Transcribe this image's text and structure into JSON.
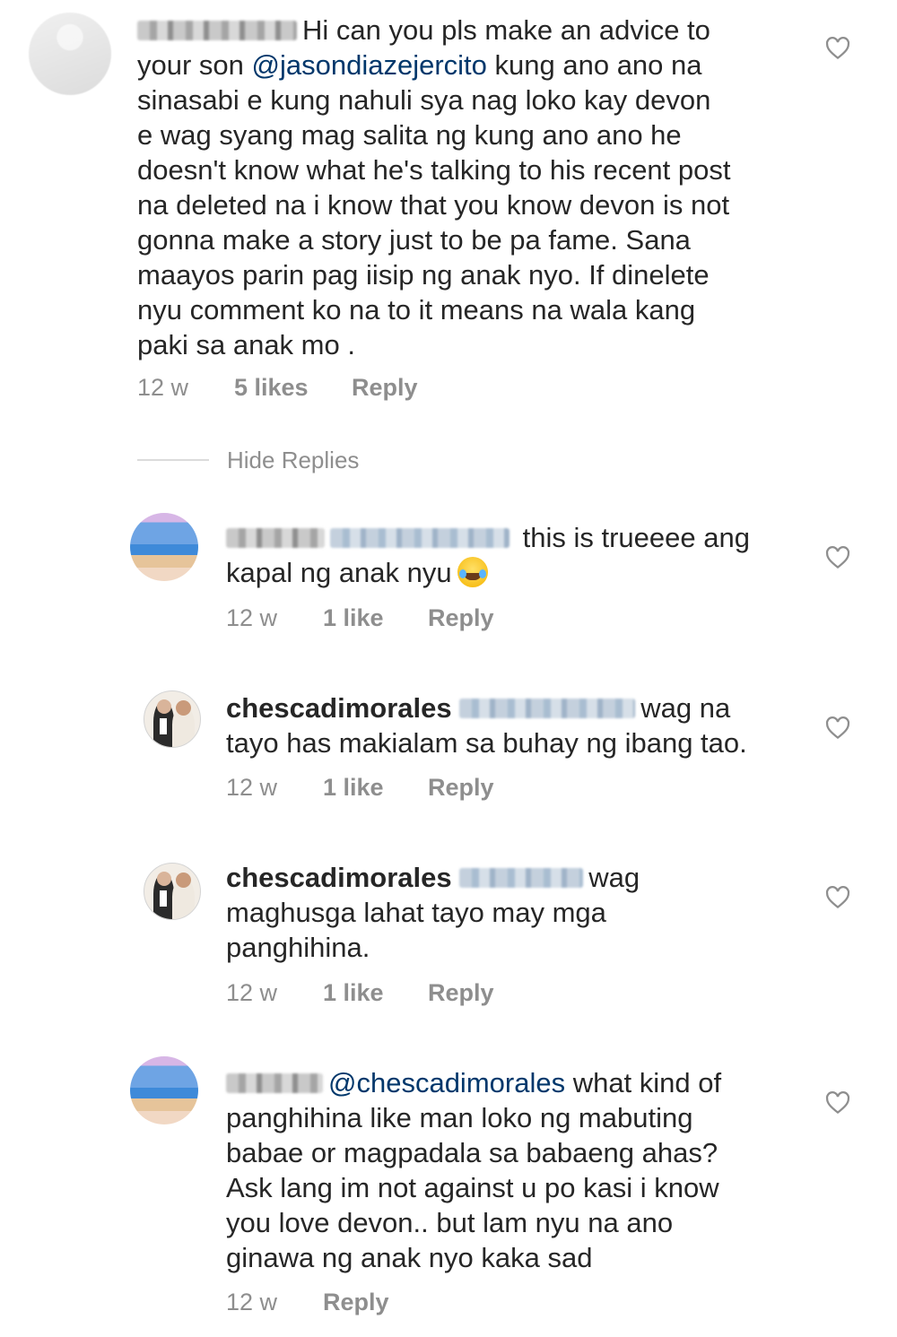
{
  "comments": [
    {
      "lead": "Hi can you pls make an advice to",
      "line_after_mention_prefix": "your son ",
      "mention": "@jasondiazejercito",
      "mention_suffix": "  kung ano ano na",
      "rest": [
        "sinasabi e kung nahuli sya nag loko kay devon",
        "e wag syang mag salita ng kung ano ano he",
        "doesn't know what he's talking to his recent post",
        "na deleted na i know that you know devon is not",
        "gonna make a story just to be pa fame. Sana",
        "maayos parin pag iisip ng anak nyo. If dinelete",
        "nyu comment ko na to it means na wala kang",
        "paki sa anak mo ."
      ],
      "time": "12 w",
      "likes": "5 likes",
      "reply": "Reply"
    },
    {
      "lead": "this is trueeee  ang",
      "rest_line": "kapal ng anak nyu",
      "time": "12 w",
      "likes": "1 like",
      "reply": "Reply"
    },
    {
      "username": "chescadimorales",
      "lead": "wag na",
      "rest_line": "tayo has makialam sa buhay ng ibang tao.",
      "time": "12 w",
      "likes": "1 like",
      "reply": "Reply"
    },
    {
      "username": "chescadimorales",
      "lead": "wag",
      "rest": [
        "maghusga lahat tayo may mga",
        "panghihina."
      ],
      "time": "12 w",
      "likes": "1 like",
      "reply": "Reply"
    },
    {
      "mention": "@chescadimorales",
      "lead": "  what kind of",
      "rest": [
        "panghihina like man loko ng mabuting",
        "babae or magpadala sa babaeng ahas?",
        "Ask lang im not against u po kasi i know",
        "you love devon.. but lam nyu na ano",
        "ginawa ng anak nyo kaka sad"
      ],
      "time": "12 w",
      "reply": "Reply"
    }
  ],
  "hide_replies": "Hide Replies",
  "icons": {
    "like": "heart-outline-icon",
    "emoji": "laughing-tears-emoji"
  }
}
